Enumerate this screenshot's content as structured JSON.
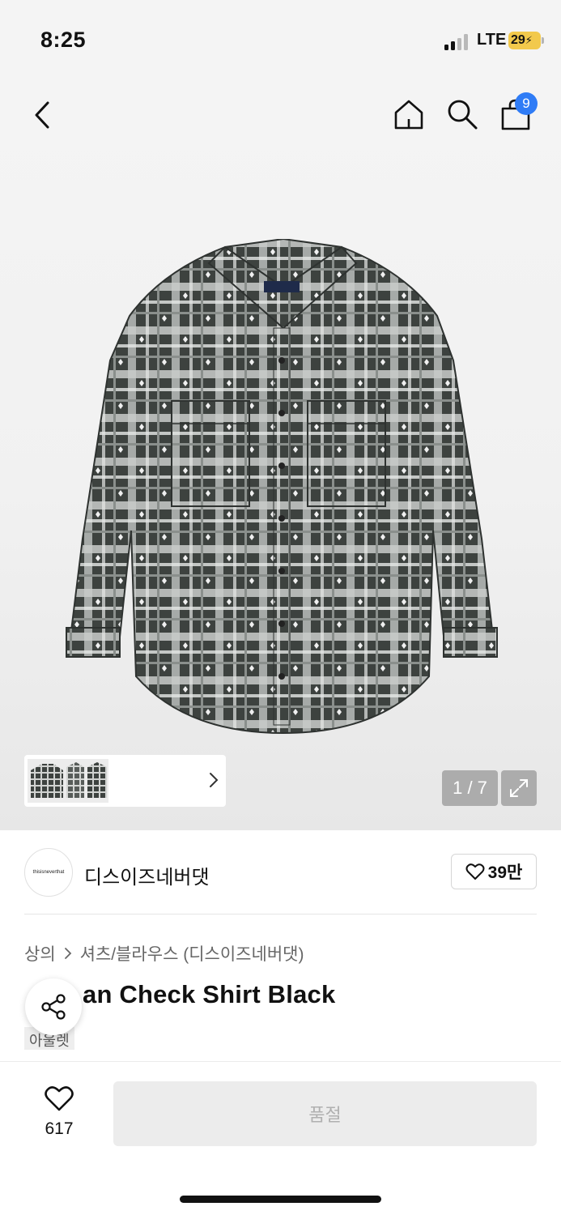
{
  "status_bar": {
    "time": "8:25",
    "network": "LTE",
    "battery": "29"
  },
  "header": {
    "cart_count": "9",
    "icons": [
      "back-arrow-icon",
      "home-icon",
      "search-icon",
      "shopping-bag-icon"
    ]
  },
  "gallery": {
    "counter": "1 / 7"
  },
  "brand": {
    "logo_text": "thisisneverthat",
    "name": "디스이즈네버댓",
    "likes": "39만"
  },
  "breadcrumb": {
    "category": "상의",
    "subcategory": "셔츠/블라우스 (디스이즈네버댓)"
  },
  "product": {
    "title": "an Check Shirt Black",
    "sub_tag": "아울렛"
  },
  "bottom_bar": {
    "wish_count": "617",
    "soldout_label": "품절"
  },
  "colors": {
    "accent": "#2f7cf6",
    "soldout_bg": "#ececec",
    "soldout_text": "#b0b0b0"
  }
}
